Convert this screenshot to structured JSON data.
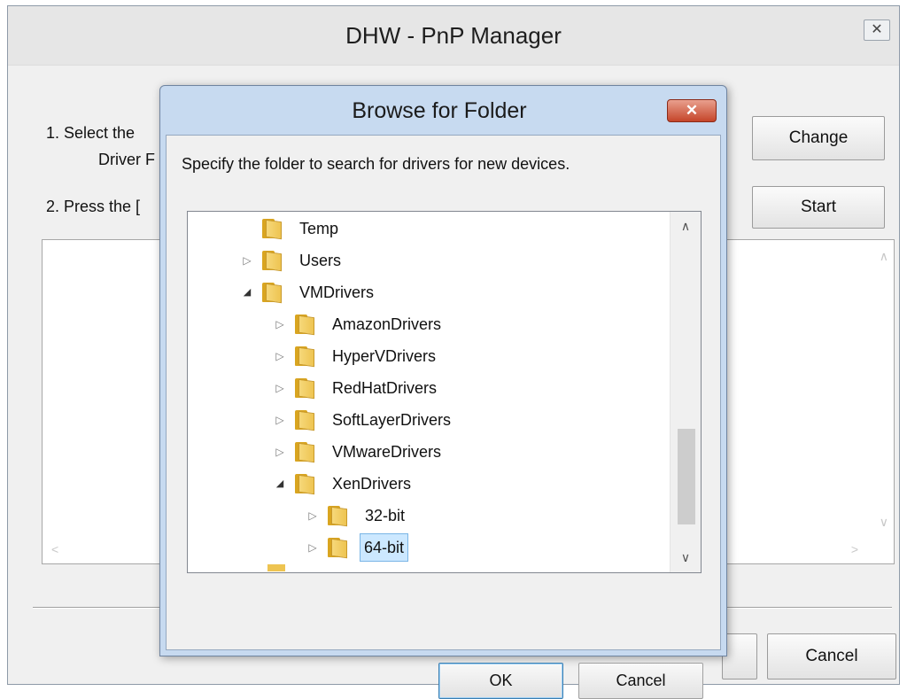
{
  "main_window": {
    "title": "DHW - PnP Manager",
    "close_glyph": "✕",
    "step1_line1": "1. Select the",
    "step1_line2": "Driver F",
    "step2": "2. Press the [",
    "change_label": "Change",
    "start_label": "Start",
    "cancel_label": "Cancel"
  },
  "browse_dialog": {
    "title": "Browse for Folder",
    "close_glyph": "✕",
    "description": "Specify the folder to search for drivers for new devices.",
    "ok_label": "OK",
    "cancel_label": "Cancel",
    "tree": [
      {
        "label": "Temp",
        "state": "leaf",
        "level": 0,
        "selected": false
      },
      {
        "label": "Users",
        "state": "collapsed",
        "level": 0,
        "selected": false
      },
      {
        "label": "VMDrivers",
        "state": "expanded",
        "level": 0,
        "selected": false
      },
      {
        "label": "AmazonDrivers",
        "state": "collapsed",
        "level": 1,
        "selected": false
      },
      {
        "label": "HyperVDrivers",
        "state": "collapsed",
        "level": 1,
        "selected": false
      },
      {
        "label": "RedHatDrivers",
        "state": "collapsed",
        "level": 1,
        "selected": false
      },
      {
        "label": "SoftLayerDrivers",
        "state": "collapsed",
        "level": 1,
        "selected": false
      },
      {
        "label": "VMwareDrivers",
        "state": "collapsed",
        "level": 1,
        "selected": false
      },
      {
        "label": "XenDrivers",
        "state": "expanded",
        "level": 1,
        "selected": false
      },
      {
        "label": "32-bit",
        "state": "collapsed",
        "level": 2,
        "selected": false
      },
      {
        "label": "64-bit",
        "state": "collapsed",
        "level": 2,
        "selected": true
      }
    ]
  },
  "icons": {
    "expander_collapsed": "▷",
    "expander_expanded": "◢",
    "scroll_up": "∧",
    "scroll_down": "∨",
    "scroll_left": "<",
    "scroll_right": ">"
  }
}
